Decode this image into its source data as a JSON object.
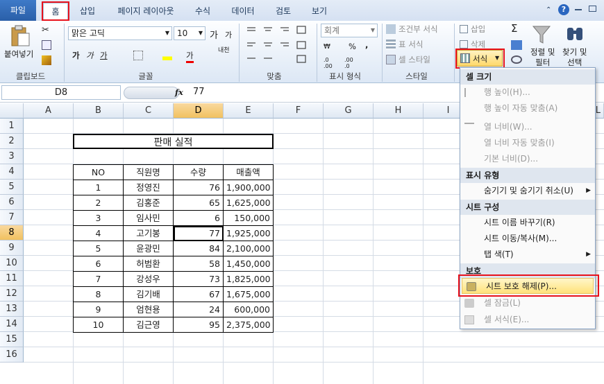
{
  "tabs": [
    "파일",
    "홈",
    "삽입",
    "페이지 레이아웃",
    "수식",
    "데이터",
    "검토",
    "보기"
  ],
  "ribbon": {
    "clipboard": {
      "paste": "붙여넣기",
      "label": "클립보드"
    },
    "font": {
      "name": "맑은 고딕",
      "size": "10",
      "label": "글꼴",
      "grow": "가",
      "shrink": "가",
      "bold": "가",
      "italic": "가",
      "underline": "가",
      "phonetic": "내천"
    },
    "align": {
      "label": "맞춤"
    },
    "number": {
      "format": "회계",
      "label": "표시 형식",
      "percent": "%",
      "comma": ","
    },
    "styles": {
      "cond": "조건부 서식",
      "table": "표 서식",
      "cell": "셀 스타일",
      "label": "스타일"
    },
    "cells": {
      "insert": "삽입",
      "delete": "삭제",
      "format": "서식"
    },
    "editing": {
      "sigma": "Σ",
      "sort": "정렬 및\n필터",
      "find": "찾기 및\n선택",
      "sort1": "정렬 및",
      "sort2": "필터",
      "find1": "찾기 및",
      "find2": "선택"
    }
  },
  "formula_bar": {
    "name_box": "D8",
    "fx": "fx",
    "value": "77"
  },
  "columns": [
    "A",
    "B",
    "C",
    "D",
    "E",
    "F",
    "G",
    "H",
    "I",
    "L"
  ],
  "rows": [
    "1",
    "2",
    "3",
    "4",
    "5",
    "6",
    "7",
    "8",
    "9",
    "10",
    "11",
    "12",
    "13",
    "14",
    "15",
    "16"
  ],
  "selected": {
    "col": "D",
    "row": "8"
  },
  "sheet": {
    "title": "판매 실적",
    "headers": [
      "NO",
      "직원명",
      "수량",
      "매출액"
    ],
    "data": [
      [
        "1",
        "정영진",
        "76",
        "1,900,000"
      ],
      [
        "2",
        "김홍준",
        "65",
        "1,625,000"
      ],
      [
        "3",
        "임사민",
        "6",
        "150,000"
      ],
      [
        "4",
        "고기봉",
        "77",
        "1,925,000"
      ],
      [
        "5",
        "윤광민",
        "84",
        "2,100,000"
      ],
      [
        "6",
        "허범환",
        "58",
        "1,450,000"
      ],
      [
        "7",
        "강성우",
        "73",
        "1,825,000"
      ],
      [
        "8",
        "김기배",
        "67",
        "1,675,000"
      ],
      [
        "9",
        "엄현용",
        "24",
        "600,000"
      ],
      [
        "10",
        "김근영",
        "95",
        "2,375,000"
      ]
    ]
  },
  "menu": {
    "sections": [
      {
        "header": "셀 크기",
        "items": [
          {
            "label": "행 높이(H)...",
            "enabled": false
          },
          {
            "label": "행 높이 자동 맞춤(A)",
            "enabled": false
          },
          {
            "label": "열 너비(W)...",
            "enabled": false
          },
          {
            "label": "열 너비 자동 맞춤(I)",
            "enabled": false
          },
          {
            "label": "기본 너비(D)...",
            "enabled": false
          }
        ]
      },
      {
        "header": "표시 유형",
        "items": [
          {
            "label": "숨기기 및 숨기기 취소(U)",
            "enabled": true,
            "submenu": true
          }
        ]
      },
      {
        "header": "시트 구성",
        "items": [
          {
            "label": "시트 이름 바꾸기(R)",
            "enabled": true
          },
          {
            "label": "시트 이동/복사(M)...",
            "enabled": true
          },
          {
            "label": "탭 색(T)",
            "enabled": true,
            "submenu": true
          }
        ]
      },
      {
        "header": "보호",
        "items": [
          {
            "label": "시트 보호 해제(P)...",
            "enabled": true,
            "highlighted": true
          },
          {
            "label": "셀 잠금(L)",
            "enabled": false
          },
          {
            "label": "셀 서식(E)...",
            "enabled": false
          }
        ]
      }
    ]
  },
  "colors": {
    "accent": "#e8111b",
    "highlight": "#ffe98a",
    "selection": "#f1c15f"
  }
}
